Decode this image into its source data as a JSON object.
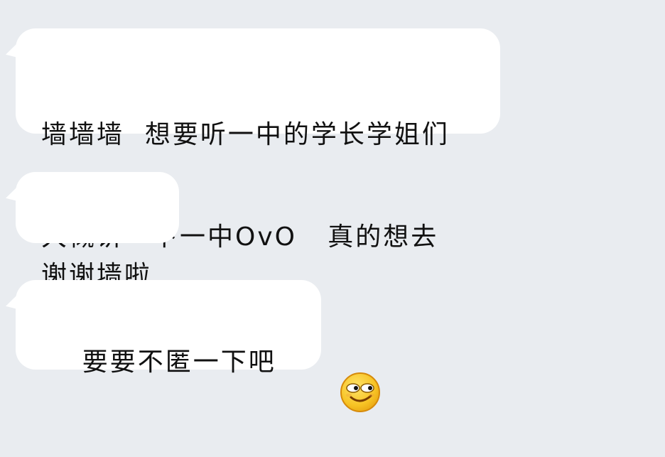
{
  "messages": [
    {
      "lines": [
        "墙墙墙  想要听一中的学长学姐们",
        "大概讲一下一中OvO   真的想去"
      ]
    },
    {
      "lines": [
        "谢谢墙啦"
      ]
    },
    {
      "lines": [
        "要要不匿一下吧"
      ],
      "emoji": "smirk-face-icon"
    }
  ],
  "colors": {
    "background": "#e9ecf0",
    "bubble": "#ffffff",
    "text": "#111111",
    "emoji_face": "#f7c324",
    "emoji_outline": "#d68a0b"
  }
}
